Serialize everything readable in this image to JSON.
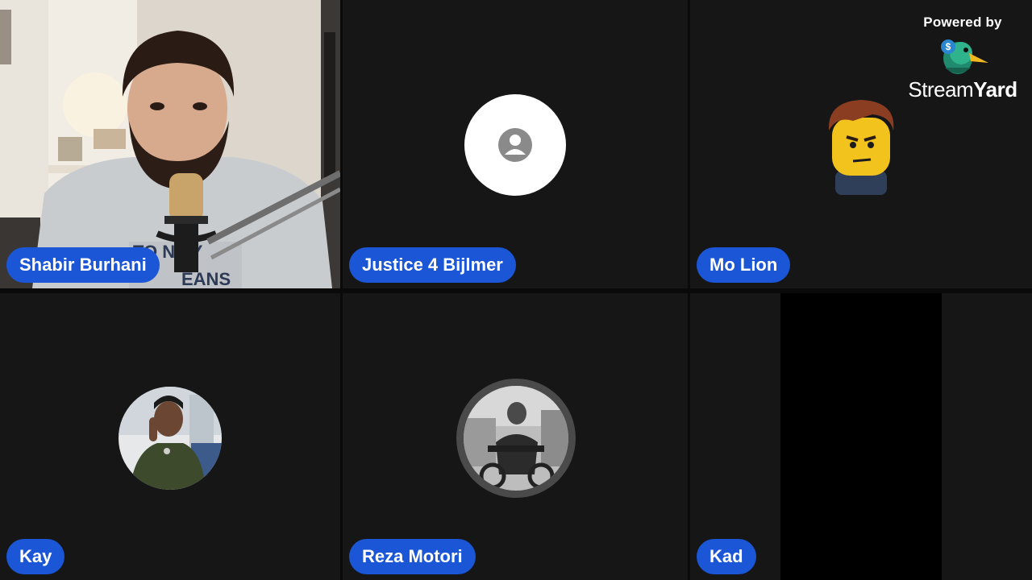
{
  "branding": {
    "powered_by": "Powered by",
    "wordmark_regular": "Stream",
    "wordmark_bold": "Yard",
    "logo_icon": "streamyard-duck-icon",
    "logo_badge": "$"
  },
  "participants": [
    {
      "name": "Shabir Burhani",
      "video": "camera-on"
    },
    {
      "name": "Justice 4 Bijlmer",
      "video": "placeholder-avatar"
    },
    {
      "name": "Mo Lion",
      "video": "lego-avatar"
    },
    {
      "name": "Kay",
      "video": "photo-avatar"
    },
    {
      "name": "Reza Motori",
      "video": "photo-avatar"
    },
    {
      "name": "Kad",
      "video": "camera-black"
    }
  ],
  "colors": {
    "name_tag": "#1a56d6",
    "tile_bg": "#161616",
    "page_bg": "#0e0e0e"
  }
}
